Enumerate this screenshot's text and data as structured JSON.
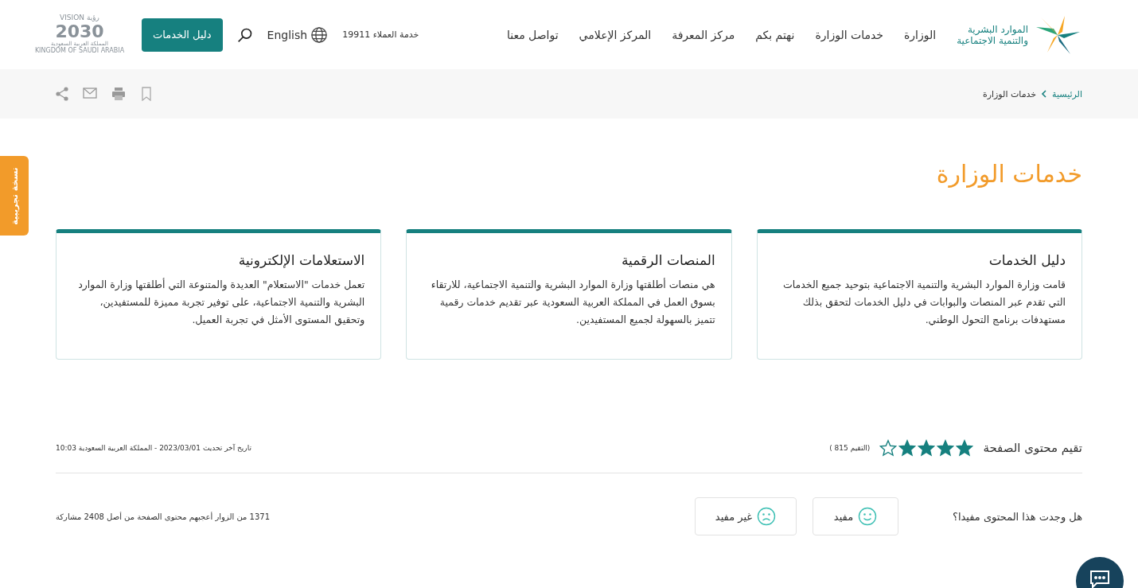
{
  "header": {
    "logo": {
      "line_1": "الموارد البشرية",
      "line_2": "والتنمية الاجتماعية"
    },
    "nav": [
      "الوزارة",
      "خدمات الوزارة",
      "نهتم بكم",
      "مركز المعرفة",
      "المركز الإعلامي",
      "تواصل معنا"
    ],
    "hotline": {
      "label": "خدمة العملاء",
      "number": "19911"
    },
    "language": "English",
    "button": "دليل الخدمات",
    "vision": {
      "word": "VISION",
      "arabic": "رؤية",
      "year": "2030",
      "line_1": "المملكة العربية السعودية",
      "line_2": "KINGDOM OF SAUDI ARABIA"
    }
  },
  "breadcrumb": [
    "الرئيسية",
    "خدمات الوزارة"
  ],
  "beta_tab": "نسخة تجريبية",
  "title": "خدمات الوزارة",
  "cards": [
    {
      "title": "دليل الخدمات",
      "text": "قامت وزارة الموارد البشرية والتنمية الاجتماعية بتوحيد جميع الخدمات التي تقدم عبر المنصات والبوابات في دليل الخدمات لتحقق بذلك مستهدفات برنامج التحول الوطني."
    },
    {
      "title": "المنصات الرقمية",
      "text": "هي منصات أطلقتها وزارة الموارد البشرية والتنمية الاجتماعية، للارتقاء بسوق العمل في المملكة العربية السعودية عبر تقديم خدمات رقمية تتميز بالسهولة لجميع المستفيدين."
    },
    {
      "title": "الاستعلامات الإلكترونية",
      "text": "تعمل خدمات \"الاستعلام\" العديدة والمتنوعة التي أطلقتها وزارة الموارد البشرية والتنمية الاجتماعية، على توفير تجربة مميزة للمستفيدين، وتحقيق المستوى الأمثل في تجربة العميل."
    }
  ],
  "rating": {
    "label": "تقيم محتوى الصفحة",
    "stars": 4,
    "count": "(التقيم 815 )"
  },
  "updated": {
    "label": "تاريخ آخر تحديث",
    "date": "2023/03/01",
    "place": "- المملكة العربية السعودية",
    "time": "10:03"
  },
  "feedback": {
    "question": "هل وجدت هذا المحتوى مفيدا؟",
    "useful": "مفيد",
    "not_useful": "غير مفيد",
    "summary": "1371 من الزوار أعجبهم محتوى الصفحة من أصل 2408 مشاركة"
  }
}
